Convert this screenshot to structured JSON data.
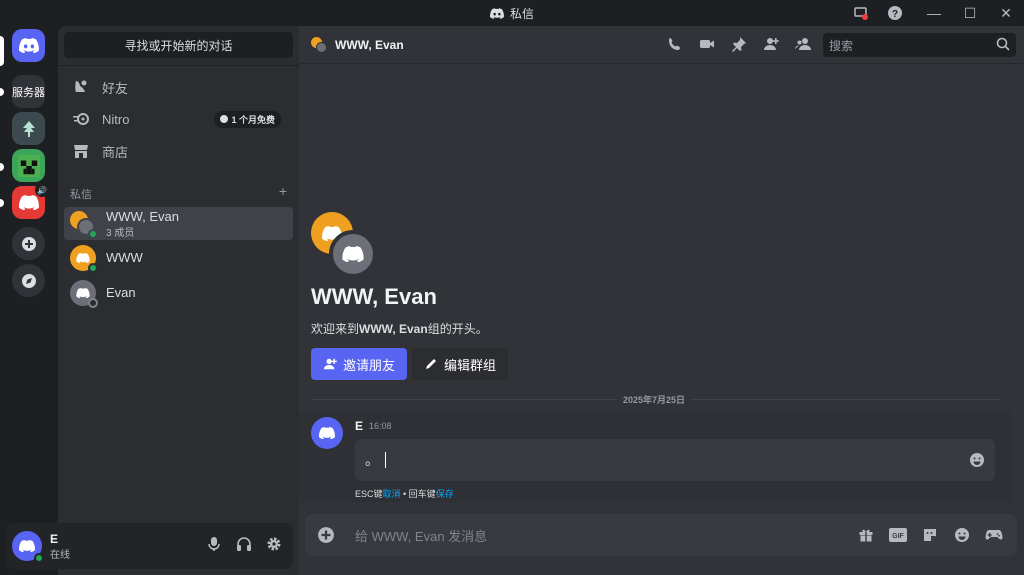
{
  "window": {
    "title": "私信"
  },
  "colors": {
    "blurple": "#5865f2",
    "online": "#23a55a",
    "offline": "#80848e",
    "orange": "#f0a020",
    "gray_avatar": "#6d6f78",
    "link": "#00a8fc"
  },
  "sidebar": {
    "search_label": "寻找或开始新的对话",
    "nav": [
      {
        "label": "好友",
        "icon": "friends-icon"
      },
      {
        "label": "Nitro",
        "icon": "nitro-icon",
        "badge": "1 个月免费"
      },
      {
        "label": "商店",
        "icon": "shop-icon"
      }
    ],
    "dm_section_label": "私信",
    "dm_add": "+",
    "dms": [
      {
        "name": "WWW, Evan",
        "sub": "3 成员",
        "type": "group",
        "active": true
      },
      {
        "name": "WWW",
        "sub": "",
        "status": "online"
      },
      {
        "name": "Evan",
        "sub": "",
        "status": "offline"
      }
    ],
    "server_folder_label": "的服务器"
  },
  "user": {
    "name": "E",
    "status": "在线"
  },
  "header": {
    "name": "WWW, Evan",
    "search_placeholder": "搜索"
  },
  "welcome": {
    "title": "WWW, Evan",
    "text_prefix": "欢迎来到",
    "text_bold": "WWW, Evan",
    "text_suffix": "组的开头。",
    "invite_label": "邀请朋友",
    "edit_label": "编辑群组"
  },
  "date_divider": "2025年7月25日",
  "message": {
    "author": "E",
    "time": "16:08",
    "edit_value": "。",
    "hint_esc": "ESC键",
    "hint_cancel": "取消",
    "hint_sep": " • 回车键",
    "hint_save": "保存"
  },
  "composer": {
    "placeholder": "给 WWW, Evan 发消息"
  }
}
